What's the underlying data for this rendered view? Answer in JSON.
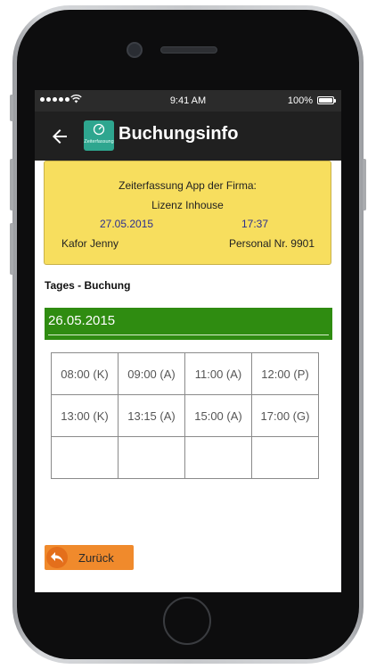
{
  "status_bar": {
    "time": "9:41 AM",
    "battery": "100%"
  },
  "app_bar": {
    "title": "Buchungsinfo",
    "logo_text": "Zeiterfassung"
  },
  "info_card": {
    "line1": "Zeiterfassung App der Firma:",
    "line2": "Lizenz Inhouse",
    "date": "27.05.2015",
    "time": "17:37",
    "name": "Kafor Jenny",
    "personal": "Personal Nr. 9901"
  },
  "section": {
    "title": "Tages - Buchung"
  },
  "date_field": {
    "value": "26.05.2015"
  },
  "bookings": {
    "row1": [
      "08:00 (K)",
      "09:00 (A)",
      "11:00 (A)",
      "12:00 (P)"
    ],
    "row2": [
      "13:00 (K)",
      "13:15 (A)",
      "15:00 (A)",
      "17:00 (G)"
    ],
    "row3": [
      "",
      "",
      "",
      ""
    ]
  },
  "back_button": {
    "label": "Zurück"
  },
  "colors": {
    "card": "#f7de5e",
    "date_bar": "#2f8c11",
    "back_button": "#f08a2c",
    "app_bar": "#202020",
    "logo": "#2ea68f"
  },
  "icons": {
    "back": "arrow-left-icon",
    "logo": "zeiterfassung-logo-icon",
    "zurueck": "undo-arrow-icon"
  }
}
